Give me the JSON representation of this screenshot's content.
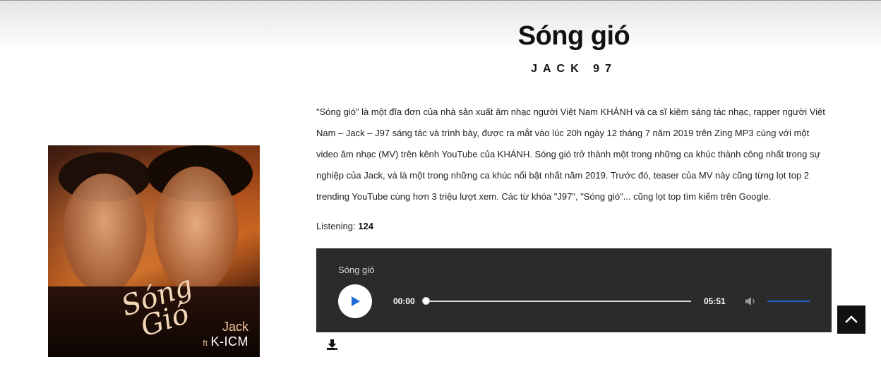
{
  "song": {
    "title": "Sóng gió",
    "artist": "JACK 97",
    "description": "\"Sóng gió\" là một đĩa đơn của nhà sản xuất âm nhạc người Việt Nam KHÁNH và ca sĩ kiêm sáng tác nhạc, rapper người Việt Nam – Jack – J97 sáng tác và trình bày, được ra mắt vào lúc 20h ngày 12 tháng 7 năm 2019 trên Zing MP3 cùng với một video âm nhạc (MV) trên kênh YouTube của KHÁNH. Sóng gió trở thành một trong những ca khúc thành công nhất trong sự nghiệp của Jack, và là một trong những ca khúc nổi bật nhất năm 2019. Trước đó, teaser của MV này cũng từng lọt top 2 trending YouTube cùng hơn 3 triệu lượt xem. Các từ khóa \"J97\", \"Sóng gió\"... cũng lọt top tìm kiếm trên Google.",
    "listening_label": "Listening:",
    "listening_count": "124"
  },
  "cover": {
    "title": "Sóng Gió",
    "artist": "Jack",
    "feat_prefix": "ft",
    "feat": "K-ICM"
  },
  "player": {
    "track_title": "Sóng gió",
    "current_time": "00:00",
    "duration": "05:51",
    "progress": 0,
    "volume": 1.0,
    "accent_color": "#1e6bd6"
  },
  "icons": {
    "play": "play-icon",
    "volume": "volume-icon",
    "download": "download-icon",
    "back_to_top": "chevron-up-icon"
  }
}
